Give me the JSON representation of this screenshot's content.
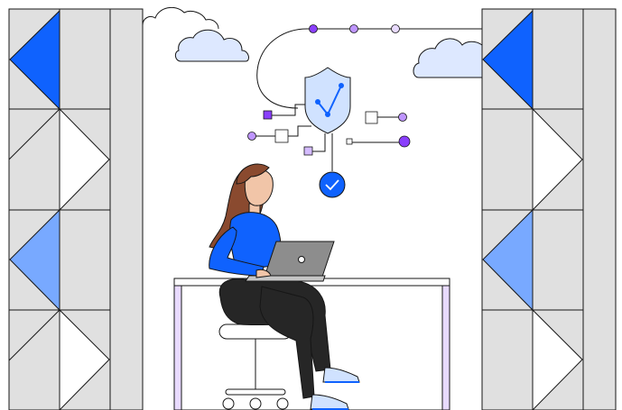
{
  "illustration": {
    "subject": "person-working-on-laptop-security",
    "icons": [
      "shield-icon",
      "checkmark-icon",
      "cloud-icon",
      "laptop-icon"
    ]
  },
  "colors": {
    "panel_gray": "#e0e0e0",
    "panel_line": "#161616",
    "blue_dark": "#0f62fe",
    "blue_light": "#78a9ff",
    "violet": "#8a3ffc",
    "violet_light": "#be95ff",
    "violet_pale": "#d4bbff",
    "shield_fill": "#d0e2ff",
    "cloud_fill": "#dde8ff",
    "skin": "#f1c5a8",
    "hair": "#8a4a2f",
    "shirt": "#0f62fe",
    "pants": "#262626",
    "laptop": "#8d8d8d",
    "desk_frame": "#e8daff"
  }
}
